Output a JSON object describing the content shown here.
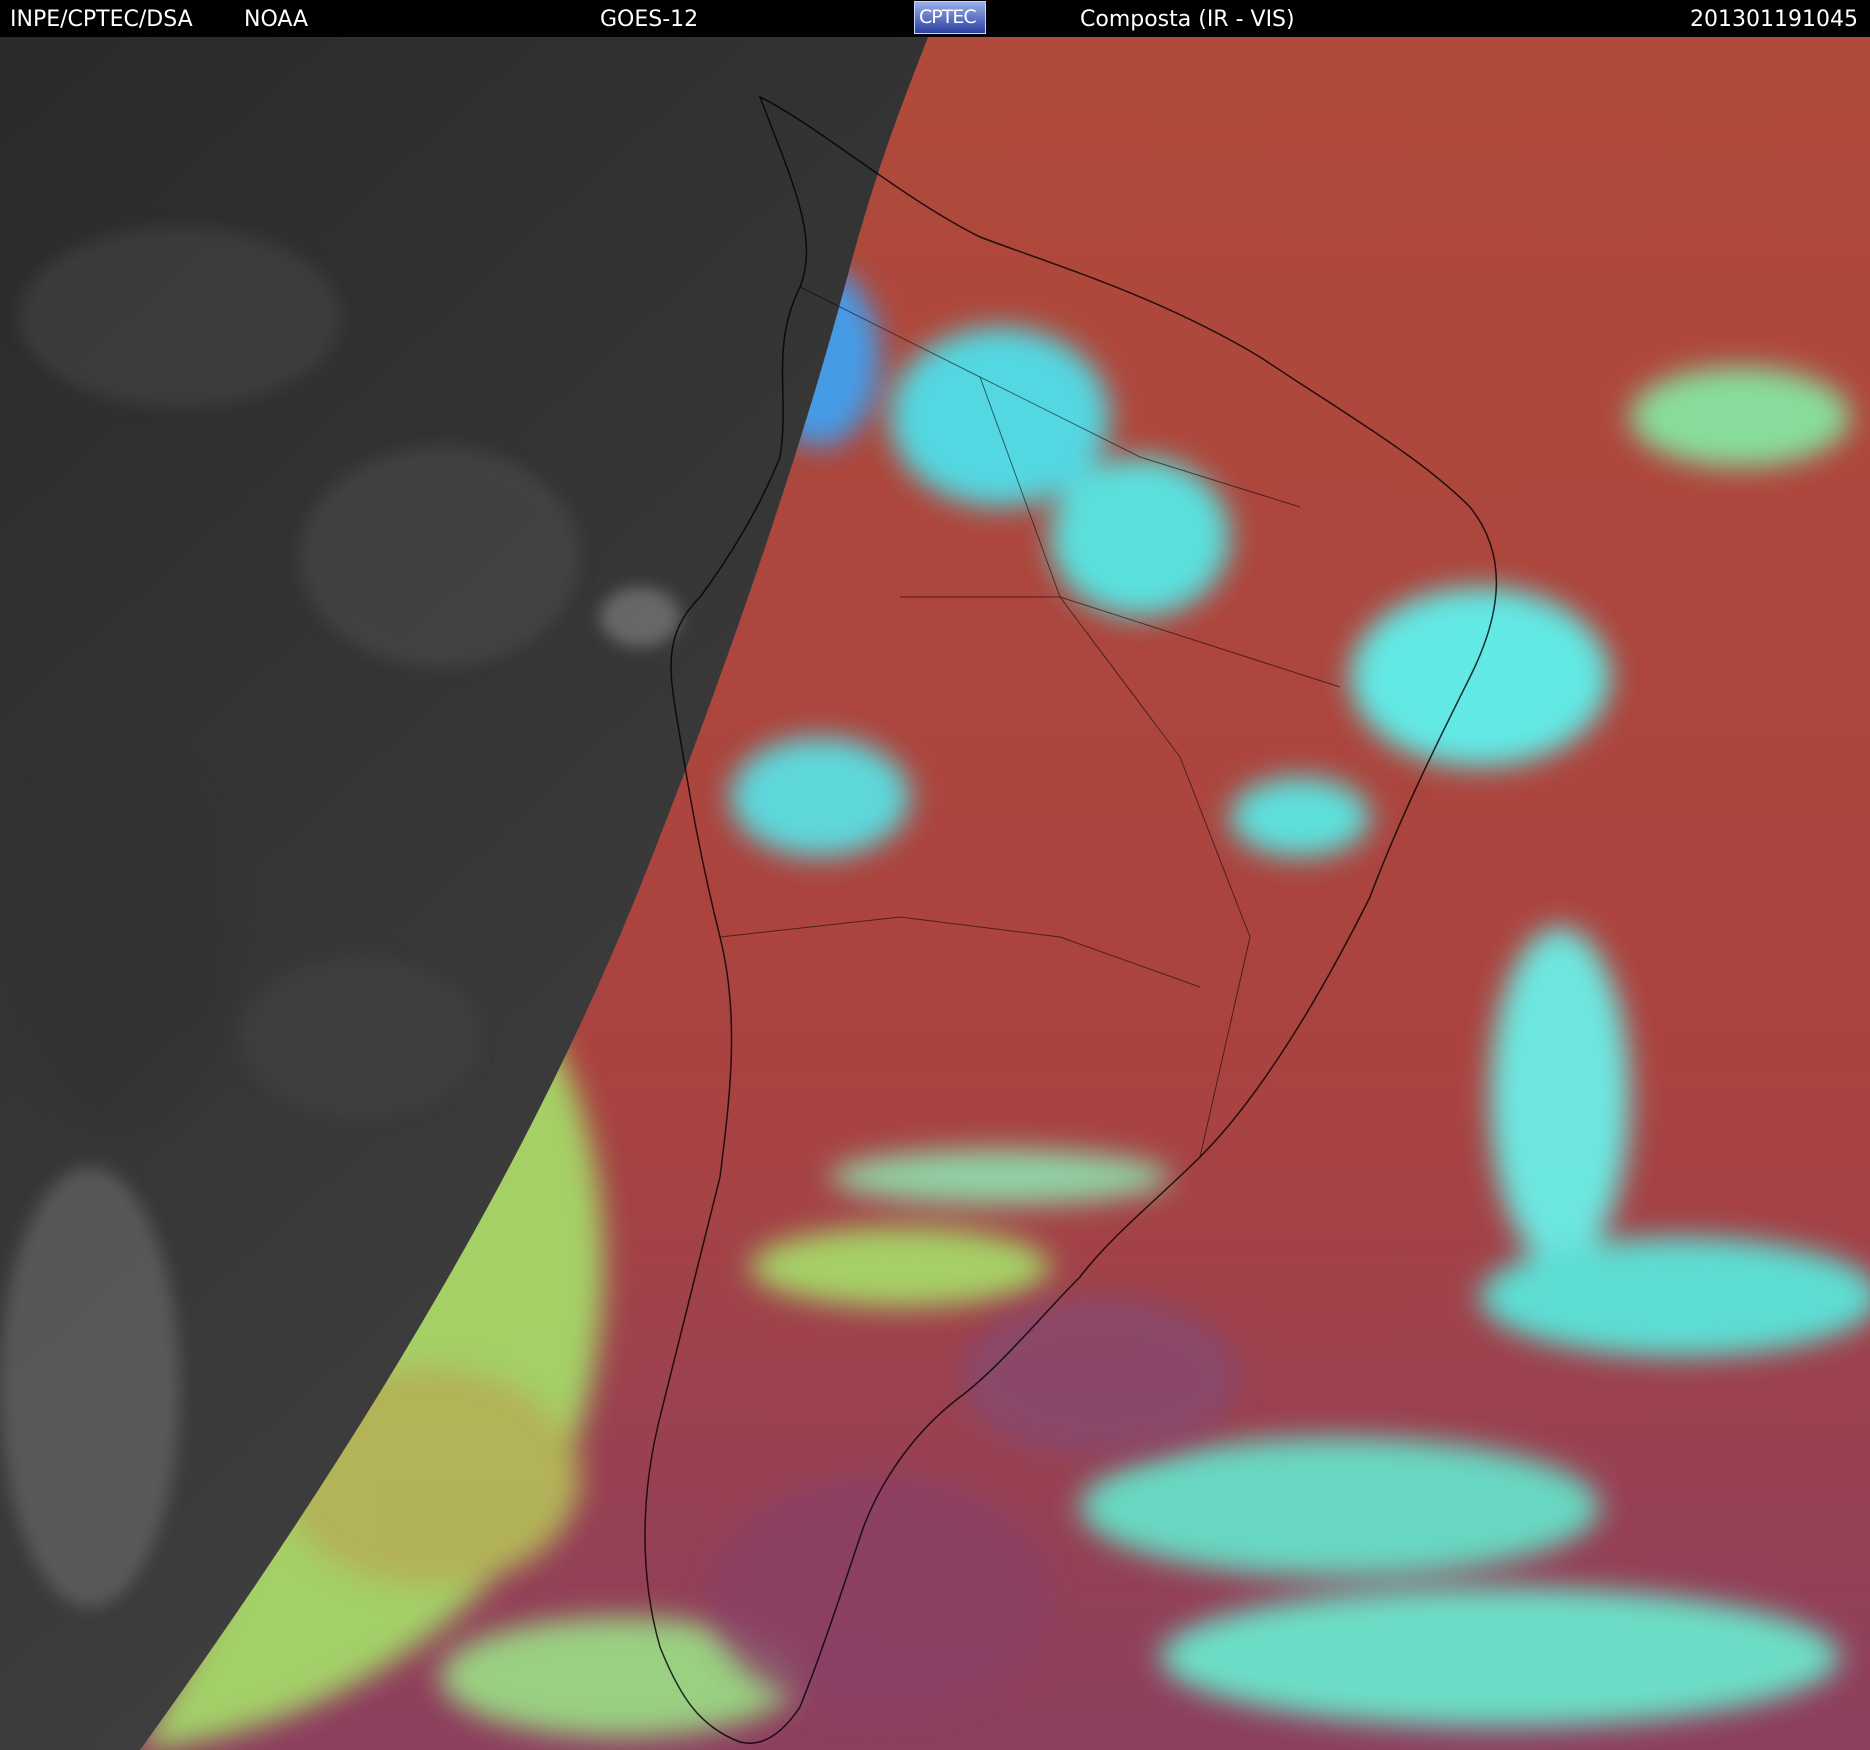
{
  "header": {
    "source": "INPE/CPTEC/DSA",
    "agency": "NOAA",
    "satellite": "GOES-12",
    "logo_text": "CPTEC",
    "product": "Composta (IR - VIS)",
    "timestamp": "201301191045"
  },
  "colors": {
    "night_gray": "#3a3a3a",
    "land_red": "#b5473a",
    "ocean_red": "#a83f3e",
    "cloud_cyan": "#4fe6e0",
    "cloud_green": "#a8e36a",
    "cloud_magenta": "#8a3f66",
    "borders": "#000000"
  }
}
